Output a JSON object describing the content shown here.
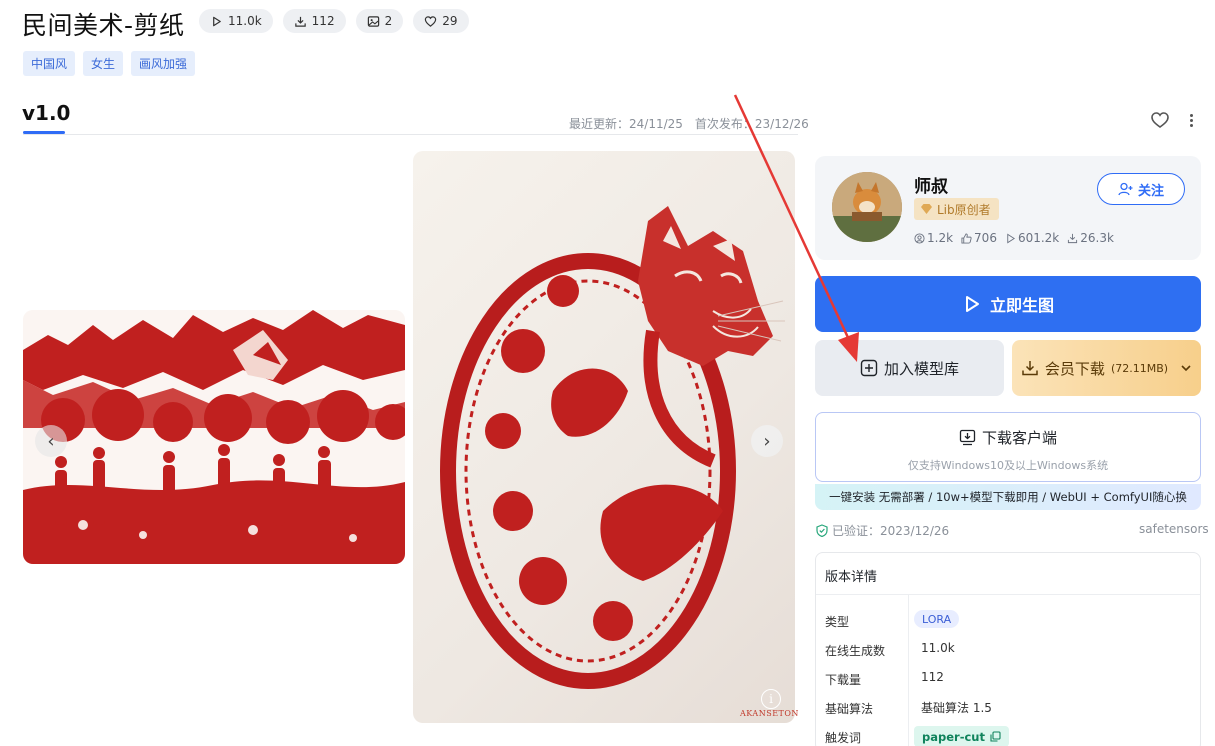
{
  "header": {
    "title": "民间美术-剪纸",
    "stats": [
      {
        "icon": "play-icon",
        "value": "11.0k"
      },
      {
        "icon": "download-icon",
        "value": "112"
      },
      {
        "icon": "image-icon",
        "value": "2"
      },
      {
        "icon": "heart-icon",
        "value": "29"
      }
    ],
    "tags": [
      "中国风",
      "女生",
      "画风加强"
    ]
  },
  "version": {
    "label": "v1.0",
    "last_updated": "最近更新：24/11/25",
    "first_published": "首次发布：23/12/26"
  },
  "gallery": {
    "watermark": "AKANSETON"
  },
  "author": {
    "name": "师叔",
    "badge": "Lib原创者",
    "follow_label": "关注",
    "stats": [
      {
        "icon": "user-icon",
        "value": "1.2k"
      },
      {
        "icon": "thumb-icon",
        "value": "706"
      },
      {
        "icon": "play-icon",
        "value": "601.2k"
      },
      {
        "icon": "download-icon",
        "value": "26.3k"
      }
    ]
  },
  "actions": {
    "generate_label": "立即生图",
    "library_label": "加入模型库",
    "member_download_label": "会员下载",
    "member_download_size": "(72.11MB)",
    "client_download_label": "下载客户端",
    "client_download_note": "仅支持Windows10及以上Windows系统",
    "client_banner": "一键安装 无需部署 / 10w+模型下载即用 / WebUI + ComfyUI随心换"
  },
  "verification": {
    "verified_label": "已验证：2023/12/26",
    "format": "safetensors"
  },
  "details": {
    "title": "版本详情",
    "rows": [
      {
        "key": "类型",
        "value": "LORA"
      },
      {
        "key": "在线生成数",
        "value": "11.0k"
      },
      {
        "key": "下载量",
        "value": "112"
      },
      {
        "key": "基础算法",
        "value": "基础算法 1.5"
      },
      {
        "key": "触发词",
        "value": "paper-cut"
      }
    ]
  },
  "colors": {
    "primary": "#2e6ff2",
    "tag_bg": "#e6eefc",
    "member_gold": "#f7cf8b",
    "papercut_red": "#c0201f",
    "annotation_arrow": "#e53935"
  }
}
